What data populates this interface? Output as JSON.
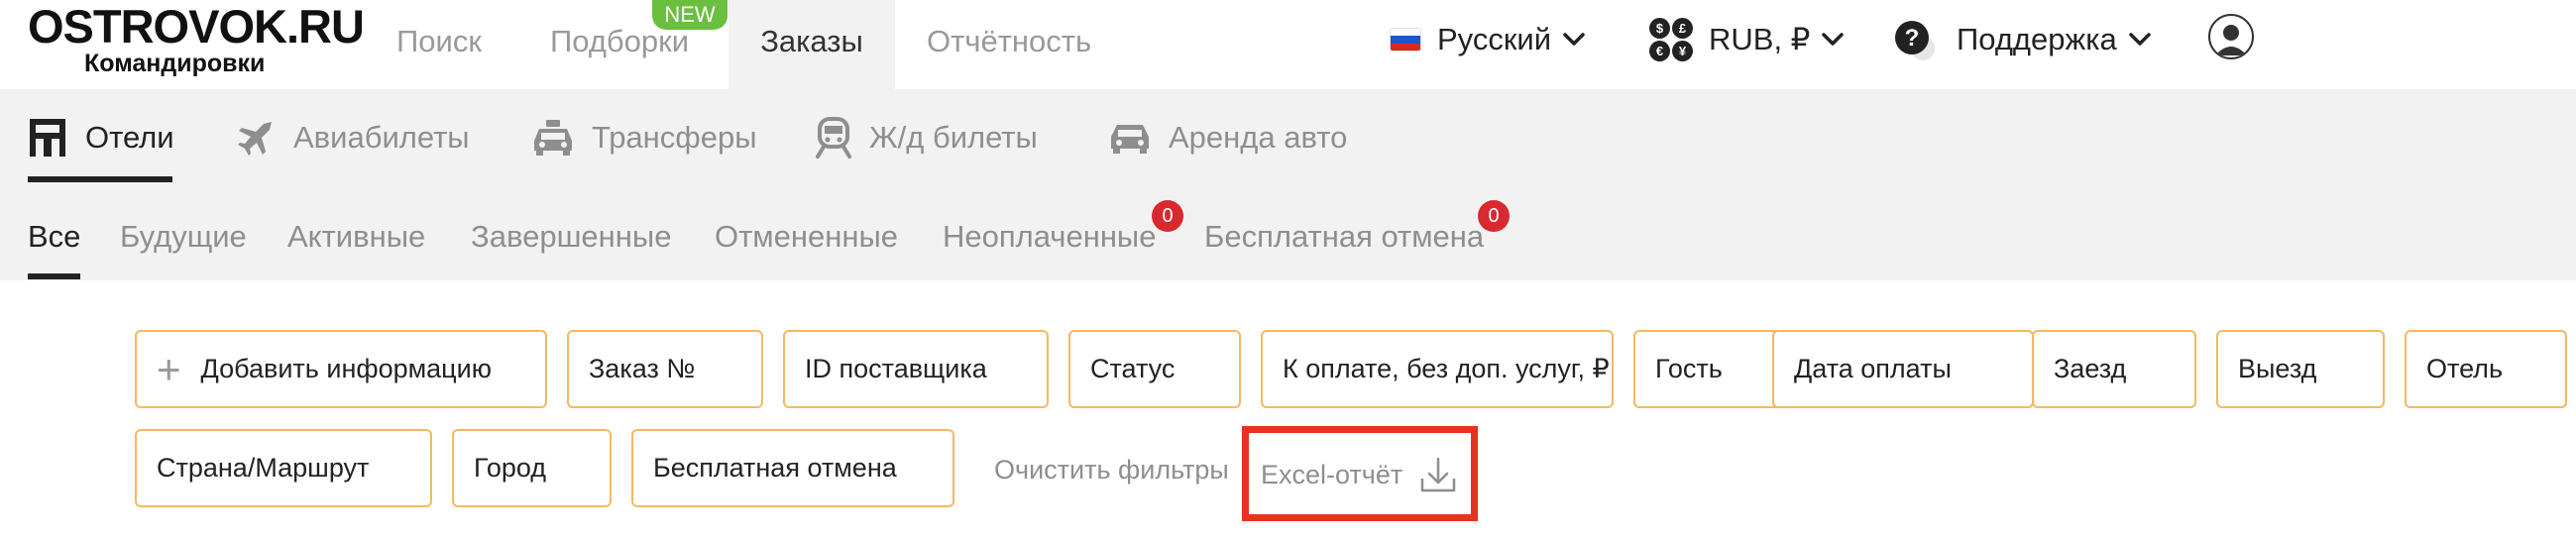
{
  "brand": {
    "name": "OSTROVOK.RU",
    "subtitle": "Командировки"
  },
  "top_nav": {
    "items": [
      {
        "label": "Поиск"
      },
      {
        "label": "Подборки",
        "badge": "NEW"
      },
      {
        "label": "Заказы",
        "active": true
      },
      {
        "label": "Отчётность"
      }
    ]
  },
  "top_right": {
    "language": "Русский",
    "currency": "RUB, ₽",
    "support": "Поддержка"
  },
  "service_tabs": [
    {
      "label": "Отели",
      "icon": "hotel-icon",
      "active": true
    },
    {
      "label": "Авиабилеты",
      "icon": "airplane-icon"
    },
    {
      "label": "Трансферы",
      "icon": "taxi-icon"
    },
    {
      "label": "Ж/д билеты",
      "icon": "train-icon"
    },
    {
      "label": "Аренда авто",
      "icon": "car-icon"
    }
  ],
  "status_tabs": [
    {
      "label": "Все",
      "active": true
    },
    {
      "label": "Будущие"
    },
    {
      "label": "Активные"
    },
    {
      "label": "Завершенные"
    },
    {
      "label": "Отмененные"
    },
    {
      "label": "Неоплаченные",
      "count": "0"
    },
    {
      "label": "Бесплатная отмена",
      "count": "0"
    }
  ],
  "filters": {
    "add_info": "Добавить информацию",
    "row1": [
      "Заказ №",
      "ID поставщика",
      "Статус",
      "К оплате, без доп. услуг, ₽",
      "Гость",
      "Дата оплаты",
      "Заезд",
      "Выезд",
      "Отель"
    ],
    "row2": [
      "Страна/Маршрут",
      "Город",
      "Бесплатная отмена"
    ],
    "clear": "Очистить фильтры",
    "excel": "Excel-отчёт"
  },
  "colors": {
    "chip_border": "#f5b862",
    "badge_red": "#d9282f",
    "new_badge": "#6bbf3f",
    "highlight": "#e8321e",
    "tab_bg": "#f2f2f2"
  }
}
